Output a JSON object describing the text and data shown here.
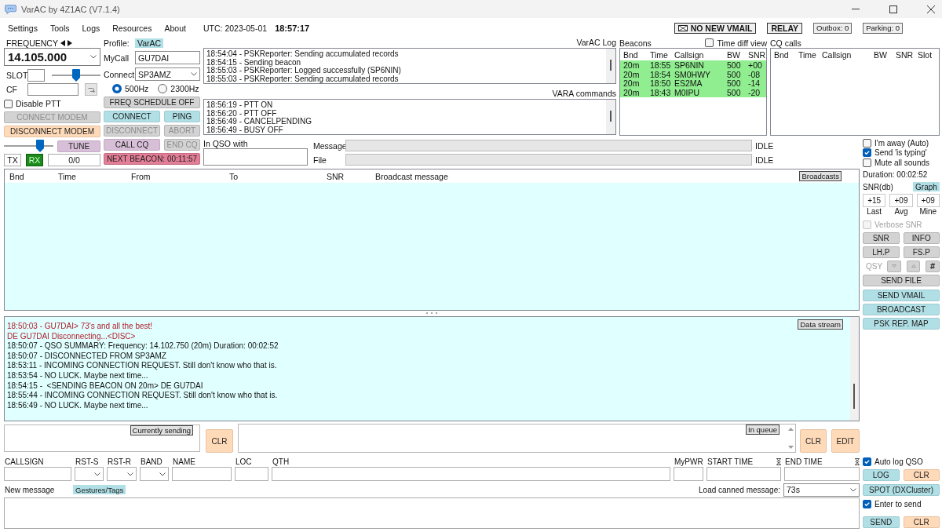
{
  "window": {
    "title": "VarAC by 4Z1AC (V7.1.4)"
  },
  "menu": [
    "Settings",
    "Tools",
    "Logs",
    "Resources",
    "About"
  ],
  "clock": {
    "date": "UTC: 2023-05-01",
    "time": "18:57:17"
  },
  "status_buttons": [
    {
      "label": "NO NEW VMAIL",
      "kind": "mail"
    },
    {
      "label": "RELAY",
      "kind": "strong"
    },
    {
      "label": "Outbox: 0",
      "kind": "counter"
    },
    {
      "label": "Parking: 0",
      "kind": "counter"
    }
  ],
  "radio": {
    "frequency_label": "FREQUENCY",
    "frequency": "14.105.000",
    "slot": {
      "label": "SLOT",
      "level": 0.5
    },
    "cf": {
      "label": "CF"
    },
    "disable_ptt": {
      "label": "Disable PTT",
      "checked": false
    },
    "modem_buttons": [
      {
        "label": "CONNECT MODEM",
        "kind": "plain",
        "disabled": true
      },
      {
        "label": "DISCONNECT MODEM",
        "kind": "peach",
        "disabled": false
      }
    ],
    "tune": {
      "level": 0.78,
      "label": "TUNE",
      "kind": "lilac"
    },
    "ptt_state": [
      {
        "label": "TX",
        "selected": false
      },
      {
        "label": "RX",
        "selected": true
      }
    ],
    "counter": "0/0"
  },
  "station": {
    "profile_label": "Profile:",
    "profile": "VarAC",
    "mycall_label": "MyCall",
    "mycall": "GU7DAI",
    "connect_label": "Connect",
    "connect": "SP3AMZ",
    "bandwidth": [
      {
        "label": "500Hz",
        "selected": true
      },
      {
        "label": "2300Hz",
        "selected": false
      }
    ],
    "button_rows": [
      [
        {
          "label": "FREQ SCHEDULE OFF",
          "kind": "plain",
          "disabled": false
        }
      ],
      [
        {
          "label": "CONNECT",
          "kind": "teal",
          "disabled": false
        },
        {
          "label": "PING",
          "kind": "teal",
          "disabled": false
        }
      ],
      [
        {
          "label": "DISCONNECT",
          "kind": "plain",
          "disabled": true
        },
        {
          "label": "ABORT",
          "kind": "plain",
          "disabled": true
        }
      ],
      [
        {
          "label": "CALL CQ",
          "kind": "lilac",
          "disabled": false
        },
        {
          "label": "END CQ",
          "kind": "plain",
          "disabled": true
        }
      ],
      [
        {
          "label": "NEXT BEACON: 00:11:57",
          "kind": "alert",
          "disabled": false
        }
      ]
    ]
  },
  "varac_log": {
    "title": "VarAC Log",
    "lines": [
      "18:54:04 - PSKReporter: Sending accumulated records",
      "18:54:15 - Sending beacon",
      "18:55:03 - PSKReporter: Logged successfully (SP6NIN)",
      "18:55:03 - PSKReporter: Sending accumulated records"
    ]
  },
  "vara_commands": {
    "title": "VARA commands",
    "lines": [
      "18:56:19 - PTT ON",
      "18:56:20 - PTT OFF",
      "18:56:49 - CANCELPENDING",
      "18:56:49 - BUSY OFF"
    ]
  },
  "beacons": {
    "title": "Beacons",
    "time_diff_view": {
      "label": "Time diff view",
      "checked": false
    },
    "columns": [
      "Bnd",
      "Time",
      "Callsign",
      "BW",
      "SNR"
    ],
    "rows": [
      [
        "20m",
        "18:55",
        "SP6NIN",
        "500",
        "+00"
      ],
      [
        "20m",
        "18:54",
        "SM0HWY",
        "500",
        "-08"
      ],
      [
        "20m",
        "18:50",
        "ES2MA",
        "500",
        "-14"
      ],
      [
        "20m",
        "18:43",
        "M0IPU",
        "500",
        "-20"
      ]
    ]
  },
  "cq_calls": {
    "title": "CQ calls",
    "columns": [
      "Bnd",
      "Time",
      "Callsign",
      "BW",
      "SNR",
      "Slot"
    ]
  },
  "qso": {
    "label": "In QSO with",
    "transfers": [
      {
        "label": "Message",
        "status": "IDLE"
      },
      {
        "label": "File",
        "status": "IDLE"
      }
    ]
  },
  "side": {
    "checks": [
      {
        "label": "I'm away (Auto)",
        "checked": false
      },
      {
        "label": "Send 'is typing'",
        "checked": true
      },
      {
        "label": "Mute all sounds",
        "checked": false
      }
    ],
    "duration": "Duration: 00:02:52",
    "snr_title": "SNR(db)",
    "graph": {
      "label": "Graph",
      "kind": "teal"
    },
    "snr": [
      {
        "value": "+15",
        "label": "Last"
      },
      {
        "value": "+09",
        "label": "Avg"
      },
      {
        "value": "+09",
        "label": "Mine"
      }
    ],
    "verbose_snr": {
      "label": "Verbose SNR",
      "checked": false,
      "disabled": true
    },
    "button_rows": [
      [
        {
          "label": "SNR",
          "kind": "plain"
        },
        {
          "label": "INFO",
          "kind": "plain"
        }
      ],
      [
        {
          "label": "LH.P",
          "kind": "plain"
        },
        {
          "label": "FS.P",
          "kind": "plain"
        }
      ]
    ],
    "qsy": {
      "label": "QSY",
      "disabled": true,
      "buttons": [
        {
          "kind": "down",
          "disabled": true
        },
        {
          "kind": "up",
          "disabled": true
        },
        {
          "kind": "text",
          "label": "#",
          "disabled": false
        }
      ]
    },
    "wide_buttons": [
      {
        "label": "SEND FILE",
        "kind": "plain"
      },
      {
        "label": "SEND VMAIL",
        "kind": "teal"
      },
      {
        "label": "BROADCAST",
        "kind": "teal"
      },
      {
        "label": "PSK REP. MAP",
        "kind": "teal"
      }
    ]
  },
  "broadcasts": {
    "button": "Broadcasts",
    "columns": [
      "Bnd",
      "Time",
      "From",
      "To",
      "SNR",
      "Broadcast message"
    ]
  },
  "data_stream": {
    "button": "Data stream",
    "lines": [
      {
        "text": "18:50:03 - GU7DAI> 73's and all the best!",
        "kind": "sent"
      },
      {
        "text": "DE GU7DAI Disconnecting...<DISC>",
        "kind": "sent"
      },
      {
        "text": "18:50:07 - QSO SUMMARY: Frequency: 14.102.750 (20m) Duration: 00:02:52",
        "kind": "event"
      },
      {
        "text": "18:50:07 - DISCONNECTED FROM SP3AMZ",
        "kind": "event"
      },
      {
        "text": "18:53:11 - INCOMING CONNECTION REQUEST. Still don't know who that is.",
        "kind": "event"
      },
      {
        "text": "18:53:54 - NO LUCK. Maybe next time...",
        "kind": "event"
      },
      {
        "text": "18:54:15 -  <SENDING BEACON ON 20m> DE GU7DAI",
        "kind": "event"
      },
      {
        "text": "18:55:44 - INCOMING CONNECTION REQUEST. Still don't know who that is.",
        "kind": "event"
      },
      {
        "text": "18:56:49 - NO LUCK. Maybe next time...",
        "kind": "event"
      }
    ]
  },
  "sending": {
    "current_label": "Currently sending",
    "clear_current": {
      "label": "CLR",
      "kind": "peach"
    },
    "queue_label": "In queue",
    "queue_buttons": [
      {
        "label": "CLR",
        "kind": "peach"
      },
      {
        "label": "EDIT",
        "kind": "peach"
      }
    ]
  },
  "log_entry": {
    "fields": [
      {
        "label": "CALLSIGN",
        "kind": "text"
      },
      {
        "label": "RST-S",
        "kind": "select"
      },
      {
        "label": "RST-R",
        "kind": "select"
      },
      {
        "label": "BAND",
        "kind": "select"
      },
      {
        "label": "NAME",
        "kind": "text"
      },
      {
        "label": "LOC",
        "kind": "text"
      },
      {
        "label": "QTH",
        "kind": "text"
      },
      {
        "label": "MyPWR",
        "kind": "text"
      },
      {
        "label": "START TIME",
        "kind": "timer"
      },
      {
        "label": "END TIME",
        "kind": "timer"
      }
    ]
  },
  "new_message": {
    "label": "New message",
    "tags": {
      "label": "Gestures/Tags",
      "kind": "teal"
    },
    "canned_label": "Load canned message:",
    "canned": "73s"
  },
  "side_bottom": {
    "auto_log": {
      "label": "Auto log QSO",
      "checked": true
    },
    "log_buttons": [
      {
        "label": "LOG",
        "kind": "teal"
      },
      {
        "label": "CLR",
        "kind": "peach"
      }
    ],
    "spot": {
      "label": "SPOT (DXCluster)",
      "kind": "teal"
    },
    "enter_to_send": {
      "label": "Enter to send",
      "checked": true
    },
    "send_buttons": [
      {
        "label": "SEND",
        "kind": "teal"
      },
      {
        "label": "CLR",
        "kind": "peach"
      }
    ]
  }
}
